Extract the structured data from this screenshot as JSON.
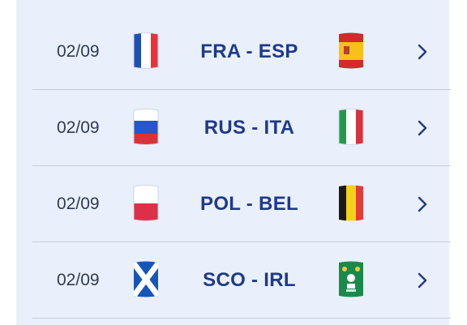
{
  "matches": [
    {
      "date": "02/09",
      "label": "FRA - ESP",
      "home_flag": "france-flag",
      "away_flag": "spain-flag"
    },
    {
      "date": "02/09",
      "label": "RUS - ITA",
      "home_flag": "russia-flag",
      "away_flag": "italy-flag"
    },
    {
      "date": "02/09",
      "label": "POL - BEL",
      "home_flag": "poland-flag",
      "away_flag": "belgium-flag"
    },
    {
      "date": "02/09",
      "label": "SCO - IRL",
      "home_flag": "scotland-flag",
      "away_flag": "ireland-rugby-crest"
    }
  ],
  "colors": {
    "panel_bg": "#eaf0fb",
    "match_text": "#1e3a8a",
    "date_text": "#2e3a59",
    "divider": "#c5ccd8"
  }
}
